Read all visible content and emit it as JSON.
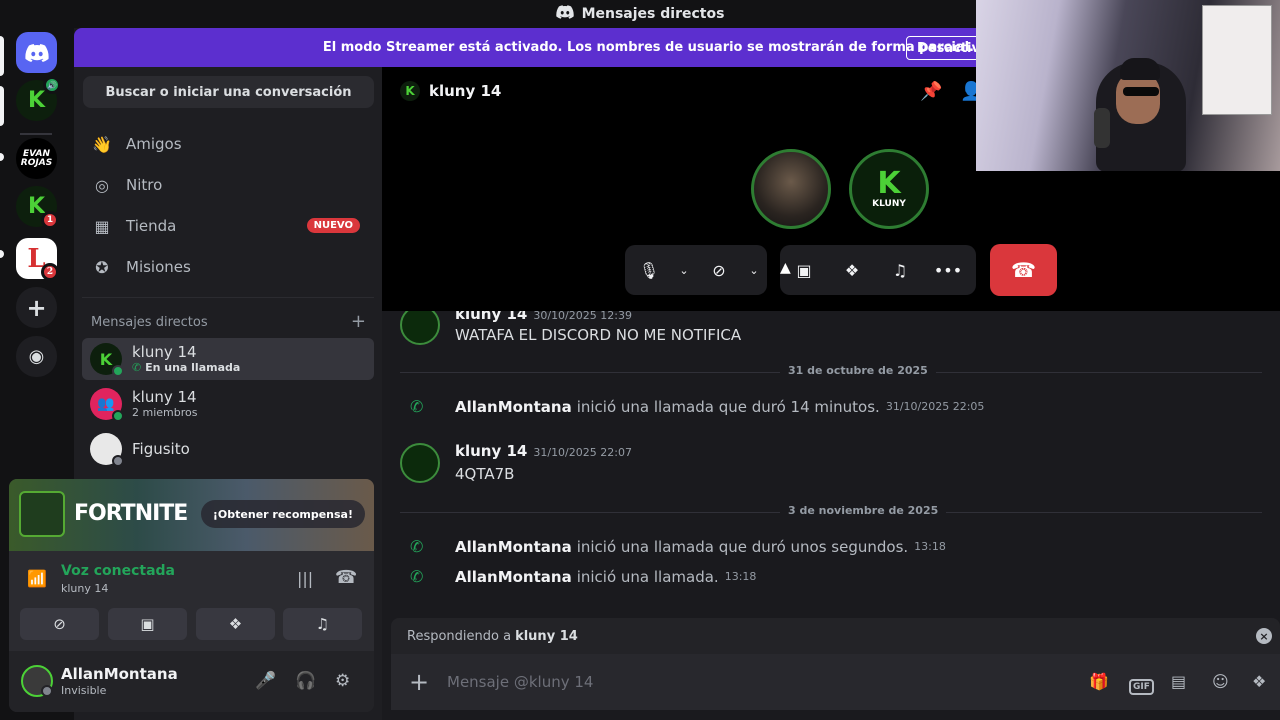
{
  "window": {
    "title": "Mensajes directos"
  },
  "banner": {
    "text": "El modo Streamer está activado. Los nombres de usuario se mostrarán de forma parcial.",
    "button": "Desactiva"
  },
  "sidebar": {
    "search_label": "Buscar o iniciar una conversación",
    "nav": [
      {
        "label": "Amigos"
      },
      {
        "label": "Nitro"
      },
      {
        "label": "Tienda",
        "badge": "NUEVO"
      },
      {
        "label": "Misiones"
      }
    ],
    "dm_header": "Mensajes directos",
    "dms": [
      {
        "name": "kluny 14",
        "sub": "En una llamada"
      },
      {
        "name": "kluny 14",
        "sub": "2 miembros"
      },
      {
        "name": "Figusito",
        "sub": ""
      }
    ]
  },
  "servers": [
    {
      "label": "EVAN ROJAS"
    },
    {
      "label": "K",
      "badge": "1"
    },
    {
      "label": "L",
      "badge": "2"
    }
  ],
  "promo": {
    "title": "FORTNITE",
    "cta": "¡Obtener recompensa!"
  },
  "voice": {
    "title": "Voz conectada",
    "channel": "kluny 14"
  },
  "user": {
    "name": "AllanMontana",
    "status": "Invisible"
  },
  "call": {
    "name": "kluny 14",
    "avatar_label": "KLUNY"
  },
  "messages": {
    "first": {
      "author": "kluny 14",
      "time": "30/10/2025 12:39",
      "text": "WATAFA EL DISCORD NO ME NOTIFICA"
    },
    "date1": "31 de octubre de 2025",
    "sys1": {
      "who": "AllanMontana",
      "text": "inició una llamada que duró 14 minutos.",
      "time": "31/10/2025 22:05"
    },
    "second": {
      "author": "kluny 14",
      "time": "31/10/2025 22:07",
      "text": "4QTA7B"
    },
    "date2": "3 de noviembre de 2025",
    "sys2": {
      "who": "AllanMontana",
      "text": "inició una llamada que duró unos segundos.",
      "time": "13:18"
    },
    "sys3": {
      "who": "AllanMontana",
      "text": "inició una llamada.",
      "time": "13:18"
    }
  },
  "composer": {
    "reply_prefix": "Respondiendo a",
    "reply_to": "kluny 14",
    "placeholder": "Mensaje @kluny 14",
    "gif_label": "GIF"
  },
  "colors": {
    "accent": "#5c2fcf",
    "green": "#23a55a",
    "danger": "#da373c"
  }
}
